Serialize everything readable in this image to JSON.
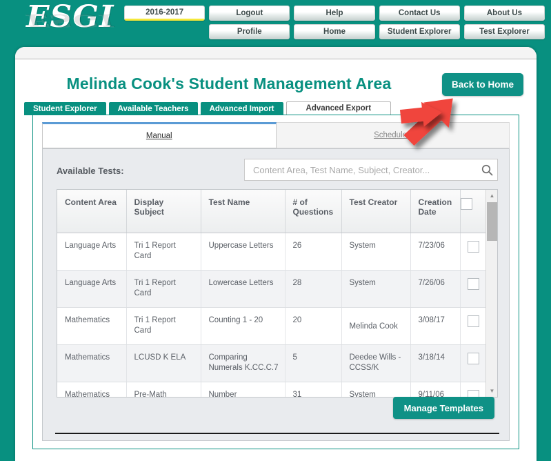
{
  "brand": {
    "logo_text": "ESGI",
    "teal": "#089080",
    "accent_yellow": "#f5e93c"
  },
  "topnav": {
    "row1": [
      {
        "label": "2016-2017",
        "kind": "year"
      },
      {
        "label": "Logout",
        "kind": "normal"
      },
      {
        "label": "Help",
        "kind": "normal"
      },
      {
        "label": "Contact Us",
        "kind": "normal"
      },
      {
        "label": "About Us",
        "kind": "normal"
      }
    ],
    "row2": [
      {
        "label": "",
        "kind": "spacer"
      },
      {
        "label": "Profile",
        "kind": "normal"
      },
      {
        "label": "Home",
        "kind": "normal"
      },
      {
        "label": "Student Explorer",
        "kind": "normal"
      },
      {
        "label": "Test Explorer",
        "kind": "normal"
      }
    ]
  },
  "page": {
    "title": "Melinda Cook's Student Management Area",
    "back_home_label": "Back to Home"
  },
  "tabs": [
    {
      "label": "Student Explorer",
      "active": false
    },
    {
      "label": "Available Teachers",
      "active": false
    },
    {
      "label": "Advanced Import",
      "active": false
    },
    {
      "label": "Advanced Export",
      "active": true
    }
  ],
  "subtabs": [
    {
      "label": "Manual",
      "active": true
    },
    {
      "label": "Scheduled",
      "active": false
    }
  ],
  "available_tests": {
    "label": "Available Tests:",
    "search_placeholder": "Content Area, Test Name, Subject, Creator...",
    "search_value": "",
    "search_icon": "search-icon"
  },
  "table": {
    "columns": [
      "Content Area",
      "Display Subject",
      "Test Name",
      "# of Questions",
      "Test Creator",
      "Creation Date",
      ""
    ],
    "rows": [
      {
        "content_area": "Language Arts",
        "display_subject": "Tri 1 Report Card",
        "test_name": "Uppercase Letters",
        "questions": "26",
        "creator": "System",
        "created": "7/23/06",
        "selected": false
      },
      {
        "content_area": "Language Arts",
        "display_subject": "Tri 1 Report Card",
        "test_name": "Lowercase Letters",
        "questions": "28",
        "creator": "System",
        "created": "7/26/06",
        "selected": false
      },
      {
        "content_area": "Mathematics",
        "display_subject": "Tri 1 Report Card",
        "test_name": "Counting 1 - 20",
        "questions": "20",
        "creator": "Melinda Cook",
        "created": "3/08/17",
        "selected": false
      },
      {
        "content_area": "Mathematics",
        "display_subject": "LCUSD K ELA",
        "test_name": "Comparing Numerals K.CC.C.7",
        "questions": "5",
        "creator": "Deedee Wills - CCSS/K",
        "created": "3/18/14",
        "selected": false
      },
      {
        "content_area": "Mathematics",
        "display_subject": "Pre-Math",
        "test_name": "Number Recognition",
        "questions": "31",
        "creator": "System",
        "created": "9/11/06",
        "selected": false
      }
    ],
    "header_checkbox": false,
    "scrollbar": {
      "up_glyph": "▲",
      "down_glyph": "▼"
    }
  },
  "footer": {
    "manage_templates_label": "Manage Templates"
  },
  "annotations": [
    {
      "name": "arrow-to-student-explorer",
      "color": "#f0443d"
    },
    {
      "name": "arrow-to-advanced-export",
      "color": "#f0443d"
    }
  ]
}
